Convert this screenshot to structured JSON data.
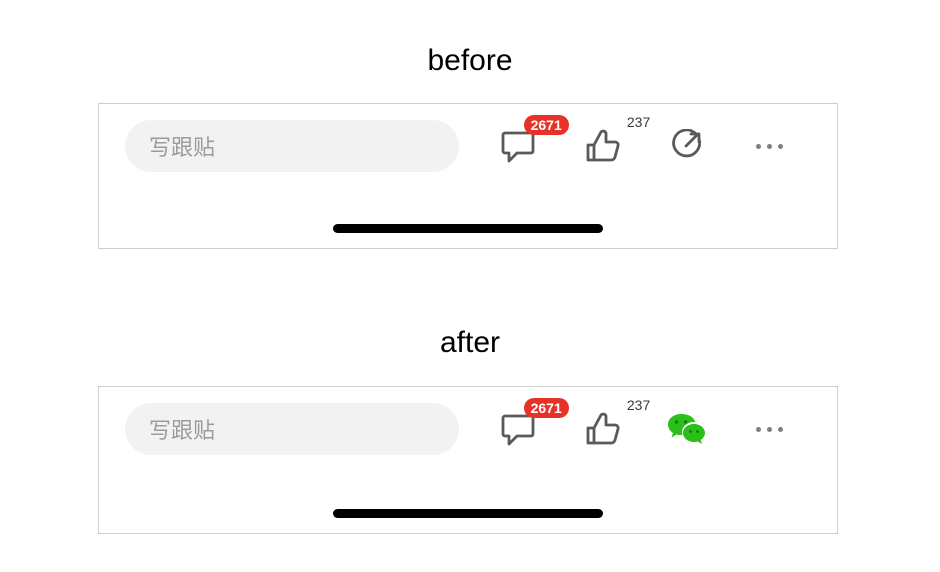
{
  "labels": {
    "before": "before",
    "after": "after"
  },
  "before": {
    "compose_placeholder": "写跟贴",
    "comment_badge": "2671",
    "like_count": "237",
    "share_variant": "arrow"
  },
  "after": {
    "compose_placeholder": "写跟贴",
    "comment_badge": "2671",
    "like_count": "237",
    "share_variant": "wechat"
  },
  "colors": {
    "badge_red": "#e73228",
    "wechat_green": "#2bbf1a",
    "icon_stroke": "#5a5a5a",
    "pill_bg": "#f2f2f2",
    "pill_text": "#9b9b9b"
  }
}
